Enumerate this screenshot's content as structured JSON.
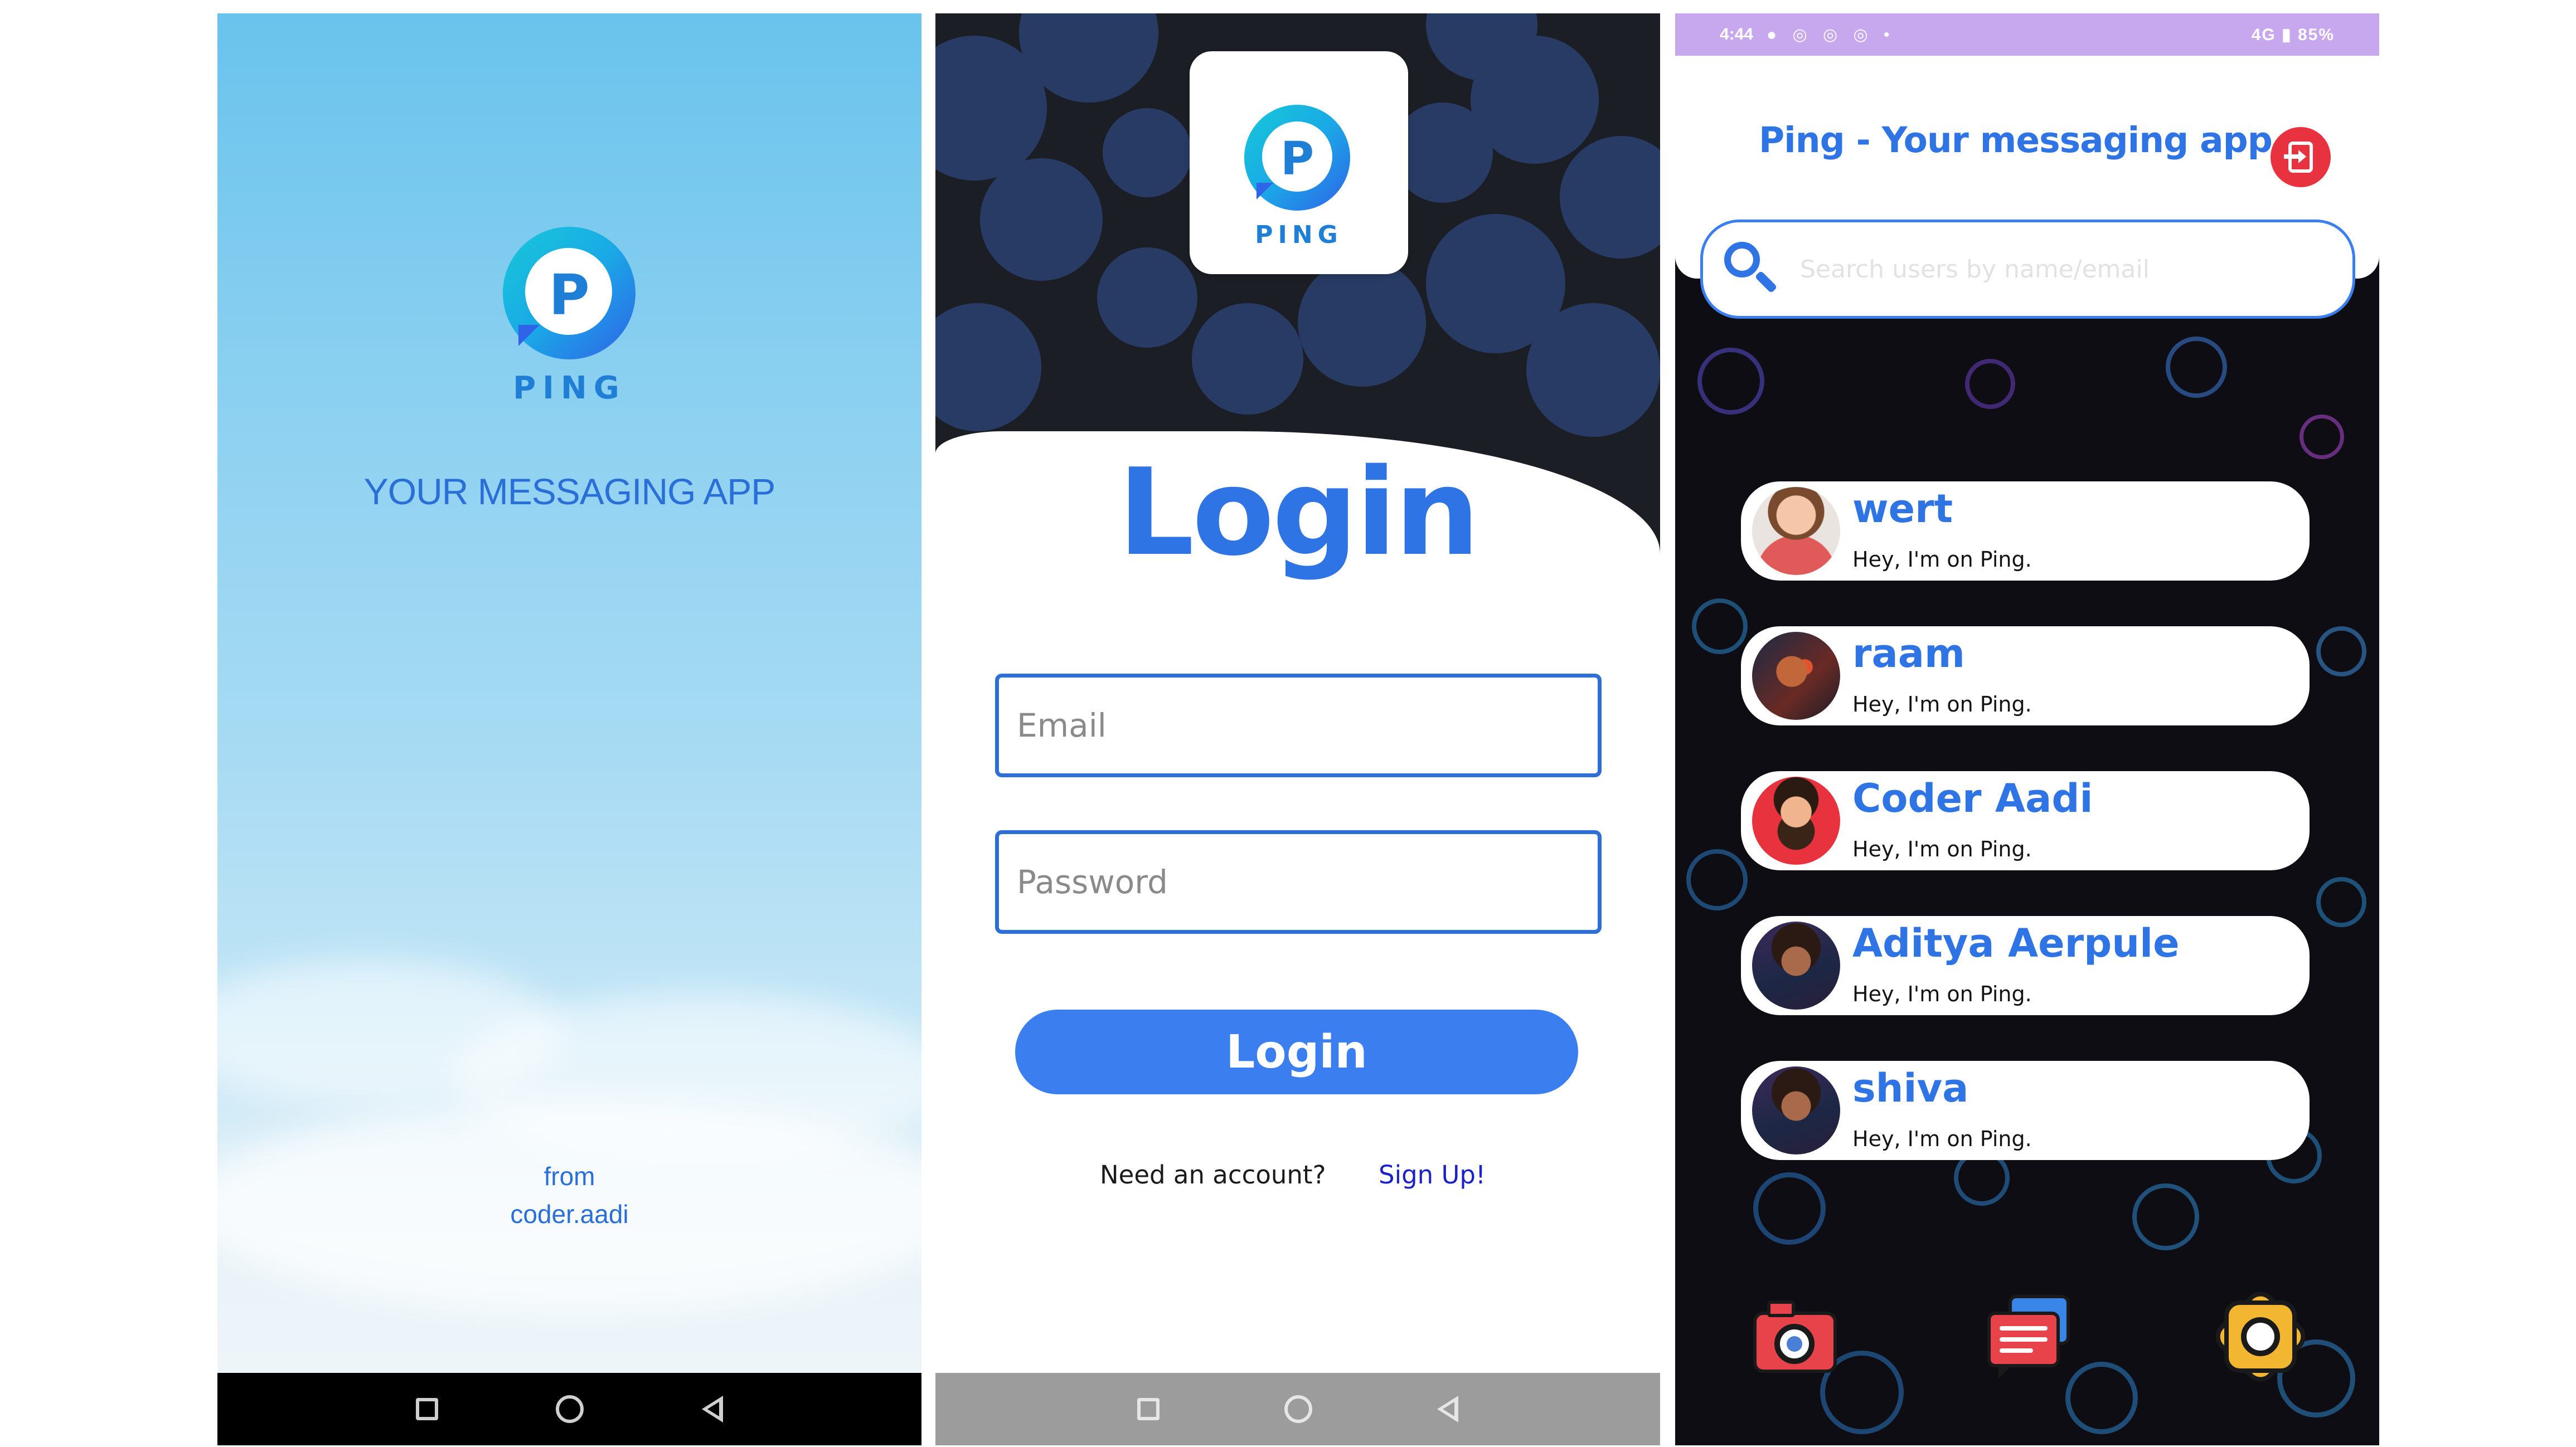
{
  "splash": {
    "logo_letter": "P",
    "logo_word": "PING",
    "tagline": "YOUR MESSAGING APP",
    "from_label": "from",
    "author": "coder.aadi"
  },
  "login": {
    "logo_letter": "P",
    "logo_word": "PING",
    "title": "Login",
    "email_placeholder": "Email",
    "password_placeholder": "Password",
    "login_button": "Login",
    "need_account": "Need an account?",
    "signup_link": "Sign Up!"
  },
  "chats": {
    "statusbar": {
      "time": "4:44",
      "network": "4G",
      "battery": "85%"
    },
    "title": "Ping - Your messaging app",
    "search_placeholder": "Search users by name/email",
    "users": [
      {
        "name": "wert",
        "status": "Hey, I'm on Ping."
      },
      {
        "name": "raam",
        "status": "Hey, I'm on Ping."
      },
      {
        "name": "Coder Aadi",
        "status": "Hey, I'm on Ping."
      },
      {
        "name": "Aditya Aerpule",
        "status": "Hey, I'm on Ping."
      },
      {
        "name": "shiva",
        "status": "Hey, I'm on Ping."
      }
    ],
    "bottom_nav": [
      "camera-icon",
      "chat-icon",
      "settings-icon"
    ]
  },
  "colors": {
    "brand_blue": "#2f74e4",
    "button_blue": "#3a7ef0",
    "logout_red": "#e8323f",
    "status_bar": "#c7a8ee"
  }
}
